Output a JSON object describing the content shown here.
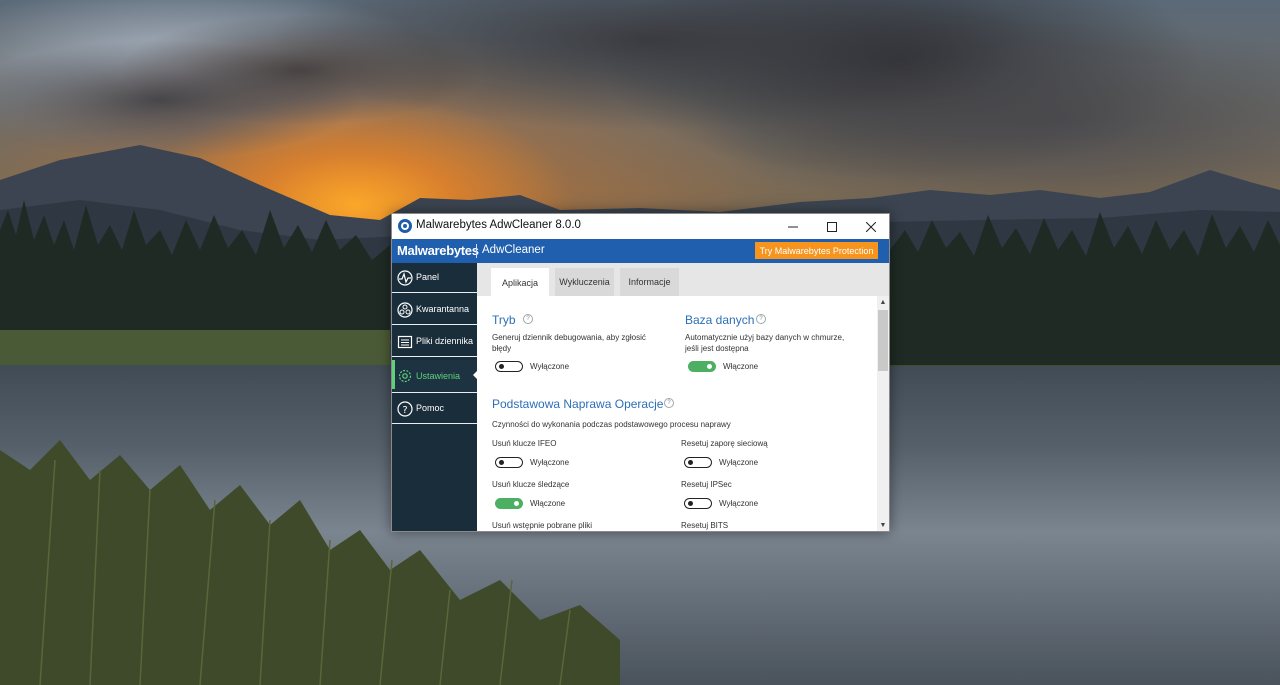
{
  "window": {
    "title": "Malwarebytes AdwCleaner 8.0.0"
  },
  "brand": {
    "logo": "Malwarebytes",
    "product": "AdwCleaner",
    "cta_label": "Try Malwarebytes Protection",
    "bar_color": "#1f5fae",
    "cta_color": "#f7941d"
  },
  "sidebar": {
    "items": [
      {
        "label": "Panel",
        "icon": "pulse-icon",
        "active": false
      },
      {
        "label": "Kwarantanna",
        "icon": "biohazard-icon",
        "active": false
      },
      {
        "label": "Pliki dziennika",
        "icon": "log-file-icon",
        "active": false
      },
      {
        "label": "Ustawienia",
        "icon": "gear-icon",
        "active": true
      },
      {
        "label": "Pomoc",
        "icon": "help-icon",
        "active": false
      }
    ],
    "active_color": "#5fd17b"
  },
  "tabs": [
    {
      "label": "Aplikacja",
      "active": true
    },
    {
      "label": "Wykluczenia",
      "active": false
    },
    {
      "label": "Informacje",
      "active": false
    }
  ],
  "settings": {
    "tryb": {
      "title": "Tryb",
      "description": "Generuj dziennik debugowania, aby zgłosić błędy",
      "toggle_state": "off",
      "toggle_label": "Wyłączone"
    },
    "baza": {
      "title": "Baza danych",
      "description": "Automatycznie użyj bazy danych w chmurze, jeśli jest dostępna",
      "toggle_state": "on",
      "toggle_label": "Włączone"
    },
    "repair": {
      "title": "Podstawowa Naprawa Operacje",
      "description": "Czynności do wykonania podczas podstawowego procesu naprawy",
      "options": [
        {
          "label": "Usuń klucze IFEO",
          "state": "off",
          "state_label": "Wyłączone"
        },
        {
          "label": "Resetuj zaporę sieciową",
          "state": "off",
          "state_label": "Wyłączone"
        },
        {
          "label": "Usuń klucze śledzące",
          "state": "on",
          "state_label": "Włączone"
        },
        {
          "label": "Resetuj IPSec",
          "state": "off",
          "state_label": "Wyłączone"
        },
        {
          "label": "Usuń wstępnie pobrane pliki",
          "state": null,
          "state_label": null
        },
        {
          "label": "Resetuj BITS",
          "state": null,
          "state_label": null
        }
      ]
    }
  }
}
